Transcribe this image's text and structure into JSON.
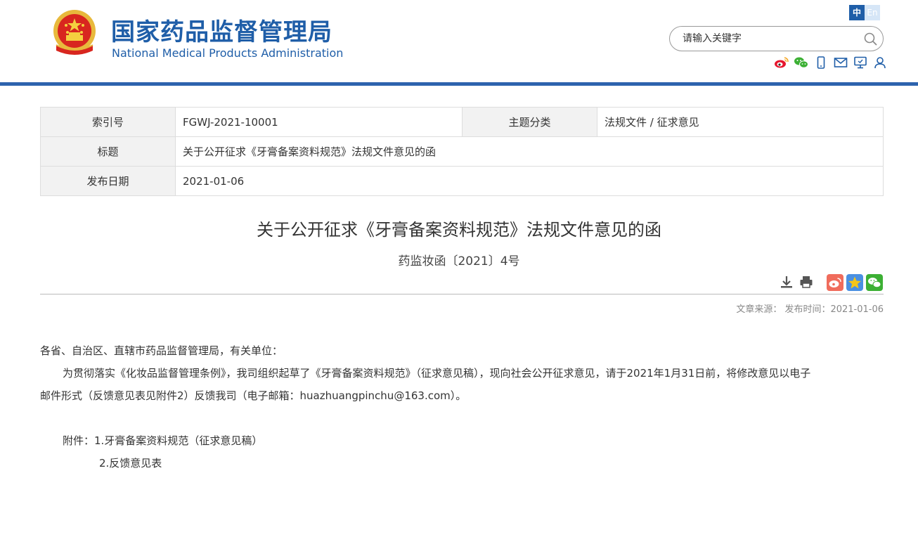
{
  "header": {
    "title_cn": "国家药品监督管理局",
    "title_en": "National Medical Products Administration",
    "lang": {
      "zh": "中",
      "en": "En"
    },
    "search": {
      "placeholder": "请输入关键字"
    },
    "social_icons": [
      "weibo-icon",
      "wechat-icon",
      "mobile-icon",
      "mail-icon",
      "monitor-icon",
      "user-icon"
    ],
    "colors": {
      "brand": "#1f5ea8",
      "bar": "#2d63ae"
    }
  },
  "meta": {
    "index_label": "索引号",
    "index_value": "FGWJ-2021-10001",
    "category_label": "主题分类",
    "category_value": "法规文件 / 征求意见",
    "title_label": "标题",
    "title_value": "关于公开征求《牙膏备案资料规范》法规文件意见的函",
    "date_label": "发布日期",
    "date_value": "2021-01-06"
  },
  "article": {
    "title": "关于公开征求《牙膏备案资料规范》法规文件意见的函",
    "doc_number": "药监妆函〔2021〕4号",
    "source_line": "文章来源：  发布时间：2021-01-06",
    "greeting": "各省、自治区、直辖市药品监督管理局，有关单位：",
    "para_line1": "为贯彻落实《化妆品监督管理条例》，我司组织起草了《牙膏备案资料规范》（征求意见稿），现向社会公开征求意见，请于2021年1月31日前，将修改意见以电子",
    "para_line2": "邮件形式（反馈意见表见附件2）反馈我司（电子邮箱：huazhuangpinchu@163.com）。",
    "attachment1": "附件：1.牙膏备案资料规范（征求意见稿）",
    "attachment2": "2.反馈意见表"
  }
}
